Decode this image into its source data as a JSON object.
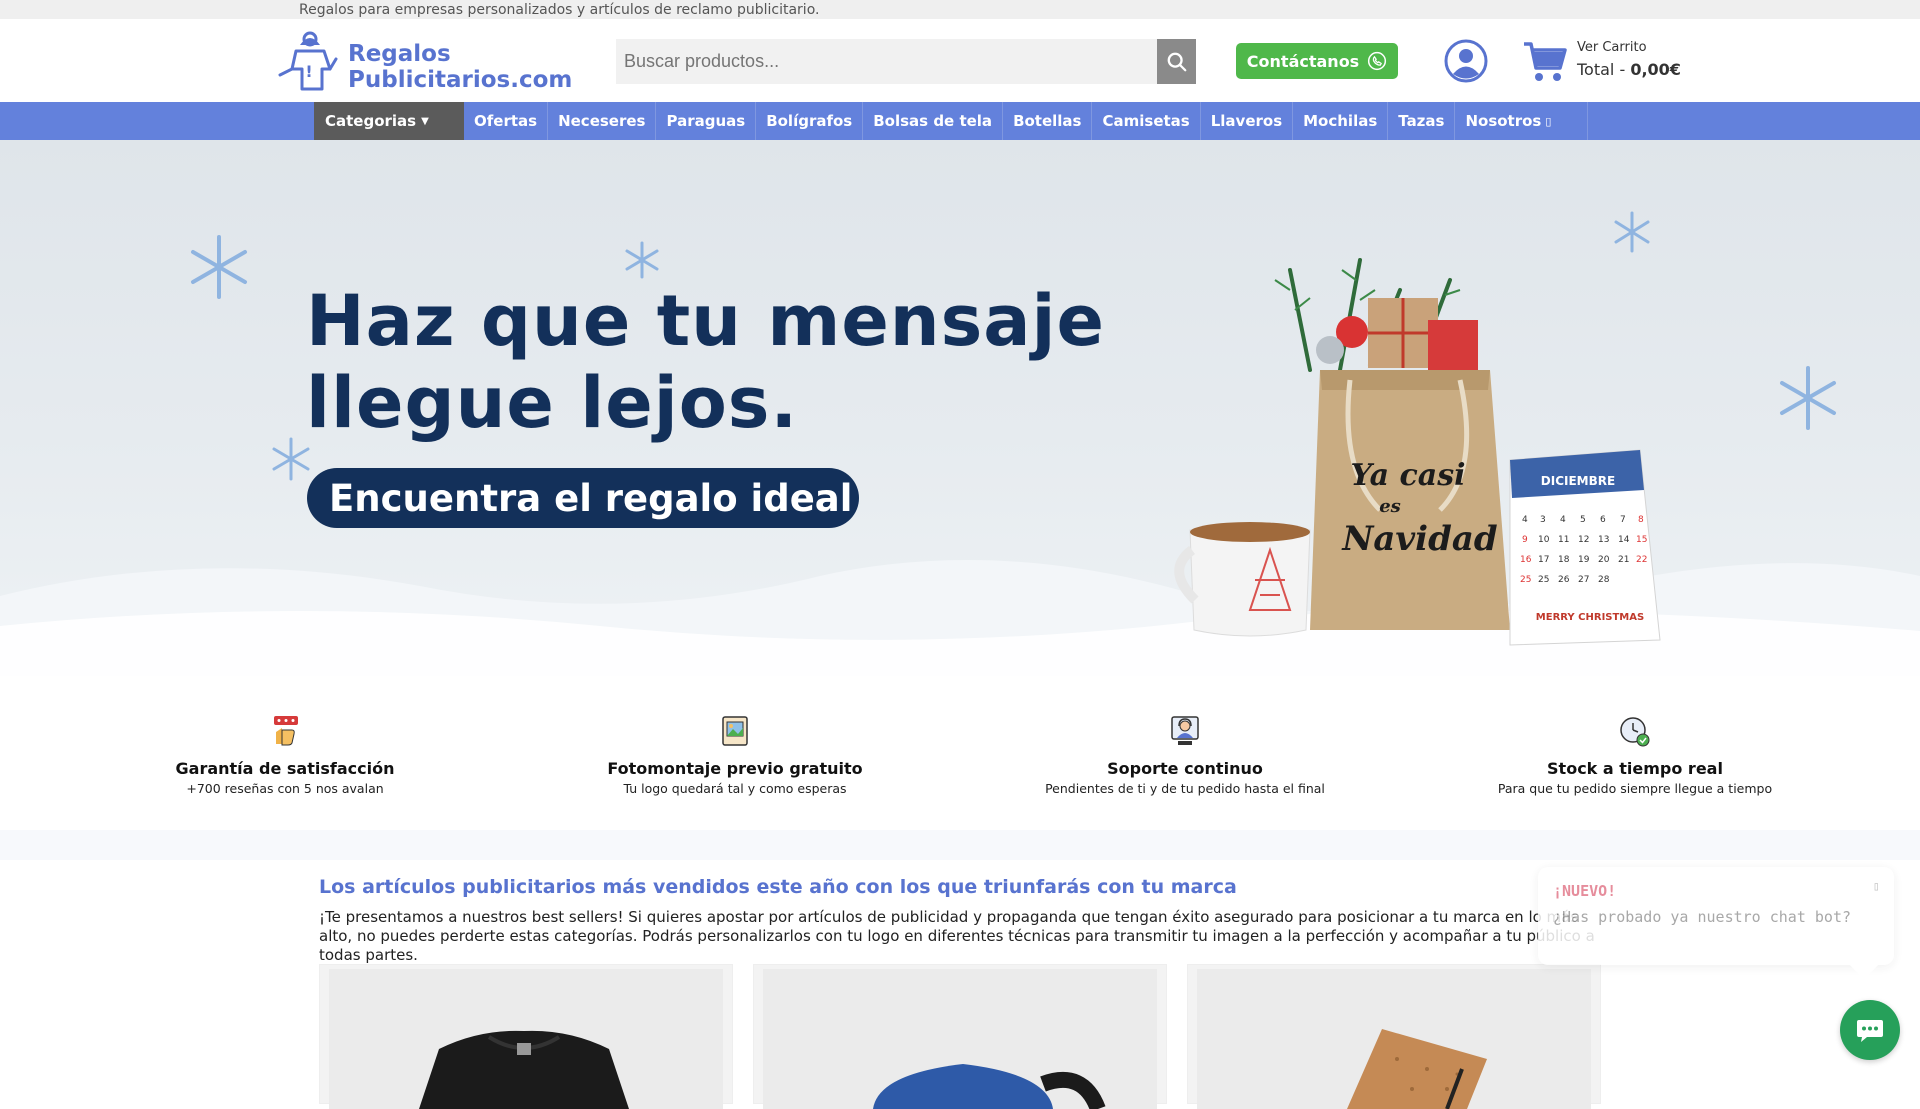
{
  "topbar": {
    "tagline": "Regalos para empresas personalizados y artículos de reclamo publicitario."
  },
  "header": {
    "logo_line1": "Regalos",
    "logo_line2": "Publicitarios.com",
    "search_placeholder": "Buscar productos...",
    "contact_label": "Contáctanos",
    "cart_label": "Ver Carrito",
    "cart_total_prefix": "Total - ",
    "cart_total_value": "0,00€"
  },
  "nav": {
    "categories_label": "Categorias",
    "items": [
      "Ofertas",
      "Neceseres",
      "Paraguas",
      "Bolígrafos",
      "Bolsas de tela",
      "Botellas",
      "Camisetas",
      "Llaveros",
      "Mochilas",
      "Tazas",
      "Nosotros"
    ]
  },
  "hero": {
    "headline_line1": "Haz que tu mensaje",
    "headline_line2": "llegue lejos.",
    "cta": "Encuentra el regalo ideal",
    "bag_text_line1": "Ya casi",
    "bag_text_line2": "es",
    "bag_text_line3": "Navidad",
    "calendar_month": "DICIEMBRE",
    "calendar_footer": "MERRY CHRISTMAS"
  },
  "features": [
    {
      "title": "Garantía de satisfacción",
      "subtitle": "+700 reseñas con 5 nos avalan",
      "icon": "thumbs-up-reviews-icon"
    },
    {
      "title": "Fotomontaje previo gratuito",
      "subtitle": "Tu logo quedará tal y como esperas",
      "icon": "image-frame-icon"
    },
    {
      "title": "Soporte continuo",
      "subtitle": "Pendientes de ti y de tu pedido hasta el final",
      "icon": "support-agent-icon"
    },
    {
      "title": "Stock a tiempo real",
      "subtitle": "Para que tu pedido siempre llegue a tiempo",
      "icon": "clock-stock-icon"
    }
  ],
  "bestsellers": {
    "title": "Los artículos publicitarios más vendidos este año con los que triunfarás con tu marca",
    "text": "¡Te presentamos a nuestros best sellers! Si quieres apostar por artículos de publicidad y propaganda que tengan éxito asegurado para posicionar a tu marca en lo más alto, no puedes perderte estas categorías. Podrás personalizarlos con tu logo en diferentes técnicas para transmitir tu imagen a la perfección y acompañar a tu público a todas partes."
  },
  "chat": {
    "badge": "¡NUEVO!",
    "message": "¿Has probado ya nuestro chat bot?"
  },
  "colors": {
    "brand_blue": "#5873cf",
    "nav_blue": "#6381dc",
    "dark_navy": "#13305a",
    "contact_green": "#4fb84a",
    "chat_green": "#26a05a"
  }
}
